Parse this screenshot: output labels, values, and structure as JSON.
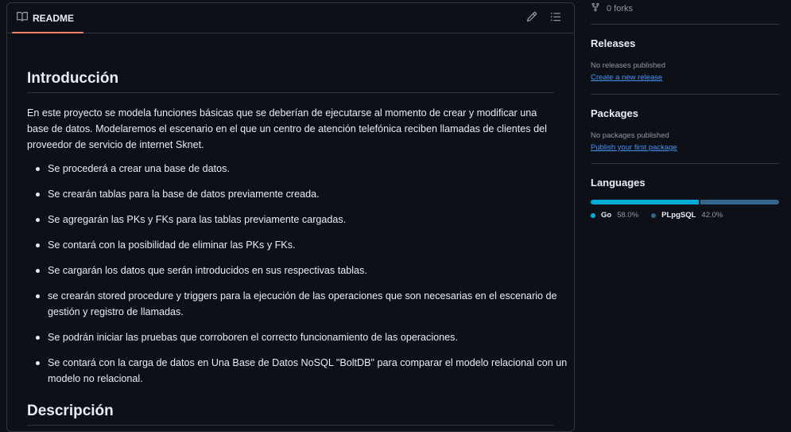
{
  "readme": {
    "tab_label": "README",
    "sections": [
      {
        "heading": "Introducción",
        "paragraph": "En este proyecto se modela funciones básicas que se deberían de ejecutarse al momento de crear y modificar una base de datos. Modelaremos el escenario en el que un centro de atención telefónica reciben llamadas de clientes del proveedor de servicio de internet Sknet.",
        "bullets": [
          "Se procederá a crear una base de datos.",
          "Se crearán tablas para la base de datos previamente creada.",
          "Se agregarán las PKs y FKs para las tablas previamente cargadas.",
          "Se contará con la posibilidad de eliminar las PKs y FKs.",
          "Se cargarán los datos que serán introducidos en sus respectivas tablas.",
          "se crearán stored procedure y triggers para la ejecución de las operaciones que son necesarias en el escenario de gestión y registro de llamadas.",
          "Se podrán iniciar las pruebas que corroboren el correcto funcionamiento de las operaciones.",
          "Se contará con la carga de datos en Una Base de Datos NoSQL \"BoltDB\" para comparar el modelo relacional con un modelo no relacional."
        ]
      },
      {
        "heading": "Descripción"
      }
    ],
    "icons": {
      "edit": "pencil-icon",
      "outline": "list-icon",
      "book": "book-icon"
    }
  },
  "sidebar": {
    "forks": "0 forks",
    "releases": {
      "title": "Releases",
      "status": "No releases published",
      "link": "Create a new release"
    },
    "packages": {
      "title": "Packages",
      "status": "No packages published",
      "link": "Publish your first package"
    },
    "languages": {
      "title": "Languages",
      "items": [
        {
          "name": "Go",
          "percent": "58.0%",
          "value": 58.0,
          "color": "#00add8"
        },
        {
          "name": "PLpgSQL",
          "percent": "42.0%",
          "value": 42.0,
          "color": "#336790"
        }
      ]
    }
  },
  "colors": {
    "background": "#0d1117",
    "border": "#30363d",
    "accent_underline": "#f78166",
    "link": "#4493f8"
  }
}
